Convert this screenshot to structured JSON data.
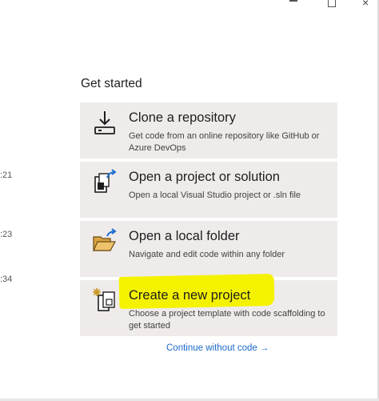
{
  "window": {
    "controls": {
      "close_glyph": "×"
    }
  },
  "sidebar": {
    "timestamps": [
      ":21",
      ":23",
      ":34"
    ]
  },
  "main": {
    "title": "Get started",
    "cards": [
      {
        "title": "Clone a repository",
        "description": "Get code from an online repository like GitHub or Azure DevOps",
        "icon": "clone-download-icon"
      },
      {
        "title": "Open a project or solution",
        "description": "Open a local Visual Studio project or .sln file",
        "icon": "open-project-icon"
      },
      {
        "title": "Open a local folder",
        "description": "Navigate and edit code within any folder",
        "icon": "open-folder-icon"
      },
      {
        "title": "Create a new project",
        "description": "Choose a project template with code scaffolding to get started",
        "icon": "new-project-icon"
      }
    ],
    "continue_link": "Continue without code →"
  },
  "colors": {
    "card_bg": "#efebea",
    "link": "#1b6ac9",
    "highlight": "#f5f200",
    "icon_accent": "#1e6fd0",
    "folder": "#d9a441"
  }
}
